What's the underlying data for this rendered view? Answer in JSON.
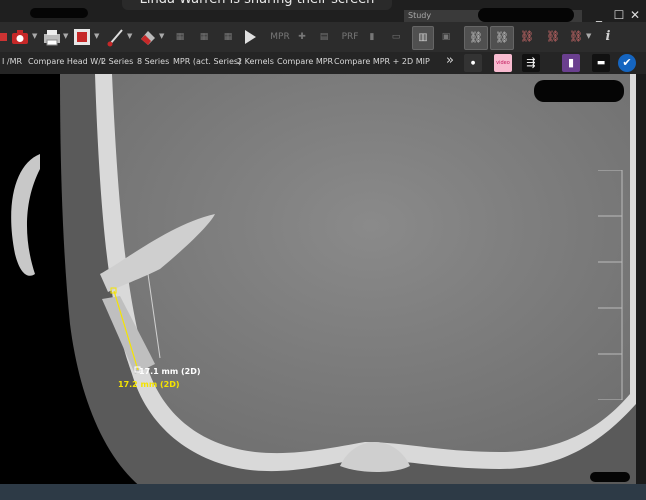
{
  "share_banner": "Linda Warren is sharing their screen",
  "study_tab": "Study",
  "window_controls": [
    "_",
    "☐",
    "✕"
  ],
  "toolbar": {
    "tools": [
      "camera-icon",
      "print-icon",
      "brush-icon",
      "eraser-icon",
      "play-icon",
      "mpr-icon",
      "crosshair-icon",
      "mip-icon",
      "prf-icon",
      "bar-icon",
      "layout-icon",
      "save-icon",
      "link-icon",
      "unlink-icon",
      "link-red-icon",
      "link-settings-icon",
      "info-icon"
    ],
    "mpr_label": "MPR",
    "prf_label": "PRF",
    "info_label": "i"
  },
  "layouts": {
    "items": [
      "I /MR",
      "Compare Head W/L",
      "2 Series",
      "8 Series",
      "MPR (act. Series)",
      "2 Kernels",
      "Compare MPR",
      "Compare MPR + 2D MIP"
    ],
    "more": "»"
  },
  "measurements": {
    "m1": "17.1 mm (2D)",
    "m2": "17.2 mm (2D)"
  },
  "colors": {
    "measure_white": "#ffffff",
    "measure_yellow": "#f5e400",
    "toolbar_bg": "#2c2c2c"
  }
}
